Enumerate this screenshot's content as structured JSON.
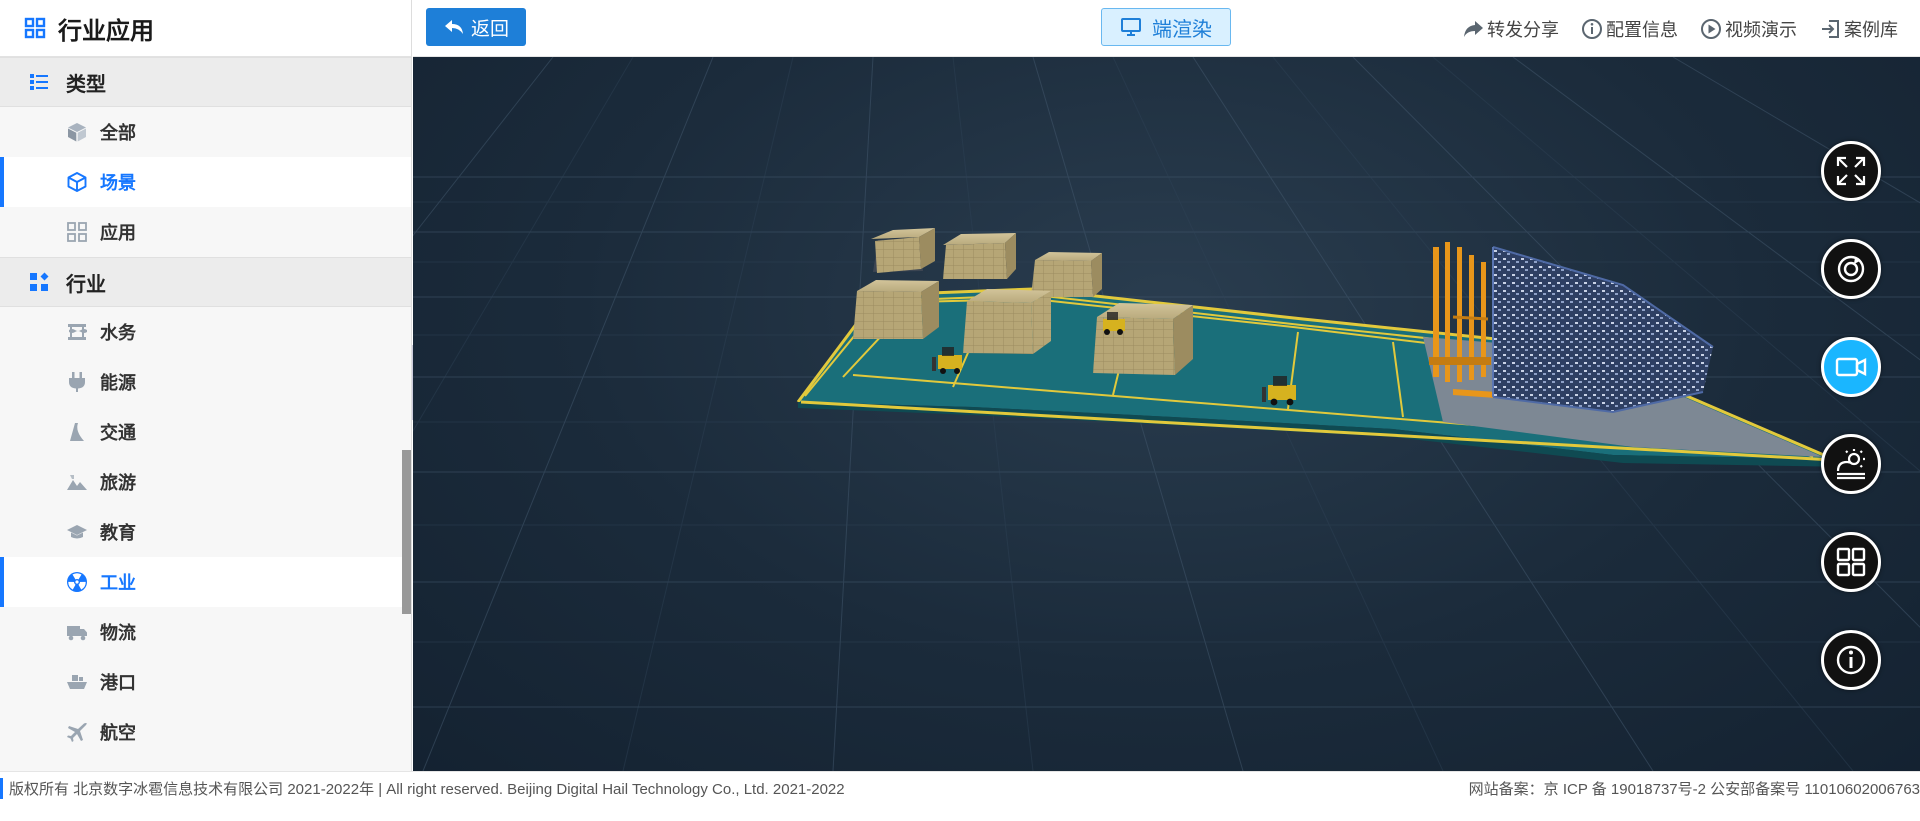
{
  "sidebar": {
    "title": "行业应用",
    "sections": [
      {
        "label": "类型",
        "items": [
          {
            "label": "全部",
            "icon": "cube-solid-icon",
            "active": false
          },
          {
            "label": "场景",
            "icon": "cube-outline-icon",
            "active": true
          },
          {
            "label": "应用",
            "icon": "grid-apps-icon",
            "active": false
          }
        ]
      },
      {
        "label": "行业",
        "items": [
          {
            "label": "水务",
            "icon": "water-icon",
            "active": false
          },
          {
            "label": "能源",
            "icon": "plug-icon",
            "active": false
          },
          {
            "label": "交通",
            "icon": "road-icon",
            "active": false
          },
          {
            "label": "旅游",
            "icon": "mountain-icon",
            "active": false
          },
          {
            "label": "教育",
            "icon": "graduation-cap-icon",
            "active": false
          },
          {
            "label": "工业",
            "icon": "radiation-icon",
            "active": true
          },
          {
            "label": "物流",
            "icon": "truck-icon",
            "active": false
          },
          {
            "label": "港口",
            "icon": "ship-icon",
            "active": false
          },
          {
            "label": "航空",
            "icon": "airplane-icon",
            "active": false
          }
        ]
      }
    ]
  },
  "topbar": {
    "back_label": "返回",
    "render_label": "端渲染",
    "tools": [
      {
        "label": "转发分享",
        "icon": "share-icon"
      },
      {
        "label": "配置信息",
        "icon": "info-circle-icon"
      },
      {
        "label": "视频演示",
        "icon": "play-circle-icon"
      },
      {
        "label": "案例库",
        "icon": "login-icon"
      }
    ]
  },
  "viewport": {
    "controls": [
      {
        "name": "fullscreen",
        "icon": "fullscreen-icon",
        "active": false
      },
      {
        "name": "rotate",
        "icon": "rotate-icon",
        "active": false
      },
      {
        "name": "camera",
        "icon": "video-camera-icon",
        "active": true
      },
      {
        "name": "weather",
        "icon": "weather-sun-icon",
        "active": false
      },
      {
        "name": "layout",
        "icon": "grid-layout-icon",
        "active": false
      },
      {
        "name": "info",
        "icon": "info-icon",
        "active": false
      }
    ]
  },
  "footer": {
    "copyright": "版权所有 北京数字冰雹信息技术有限公司 2021-2022年 | All right reserved. Beijing Digital Hail Technology Co., Ltd. 2021-2022",
    "icp": "网站备案：京 ICP 备 19018737号-2 公安部备案号 11010602006763"
  },
  "colors": {
    "accent": "#1677ff",
    "button_blue": "#1e7fd8",
    "active_ctrl": "#1ab6ff"
  }
}
